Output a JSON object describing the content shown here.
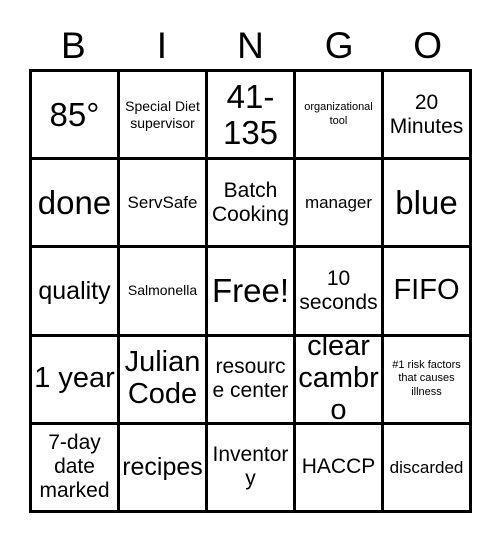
{
  "card": {
    "header_letters": [
      "B",
      "I",
      "N",
      "G",
      "O"
    ],
    "background_color": "#ffffff",
    "border_color": "#000000",
    "text_color": "#000000",
    "rows": [
      [
        {
          "text": "85°",
          "size": "xxl"
        },
        {
          "text": "Special Diet supervisor",
          "size": "xs"
        },
        {
          "text": "41-135",
          "size": "xxl"
        },
        {
          "text": "organizational tool",
          "size": "xxs"
        },
        {
          "text": "20 Minutes",
          "size": "md"
        }
      ],
      [
        {
          "text": "done",
          "size": "xxl"
        },
        {
          "text": "ServSafe",
          "size": "sm"
        },
        {
          "text": "Batch Cooking",
          "size": "md"
        },
        {
          "text": "manager",
          "size": "sm"
        },
        {
          "text": "blue",
          "size": "xxl"
        }
      ],
      [
        {
          "text": "quality",
          "size": "lg"
        },
        {
          "text": "Salmonella",
          "size": "xs"
        },
        {
          "text": "Free!",
          "size": "xxl"
        },
        {
          "text": "10 seconds",
          "size": "md"
        },
        {
          "text": "FIFO",
          "size": "xl"
        }
      ],
      [
        {
          "text": "1 year",
          "size": "xl"
        },
        {
          "text": "Julian Code",
          "size": "xl"
        },
        {
          "text": "resource center",
          "size": "md"
        },
        {
          "text": "clear cambro",
          "size": "xl"
        },
        {
          "text": "#1 risk factors that causes illness",
          "size": "xxs"
        }
      ],
      [
        {
          "text": "7-day date marked",
          "size": "md"
        },
        {
          "text": "recipes",
          "size": "lg"
        },
        {
          "text": "Inventory",
          "size": "md"
        },
        {
          "text": "HACCP",
          "size": "md"
        },
        {
          "text": "discarded",
          "size": "sm"
        }
      ]
    ]
  }
}
